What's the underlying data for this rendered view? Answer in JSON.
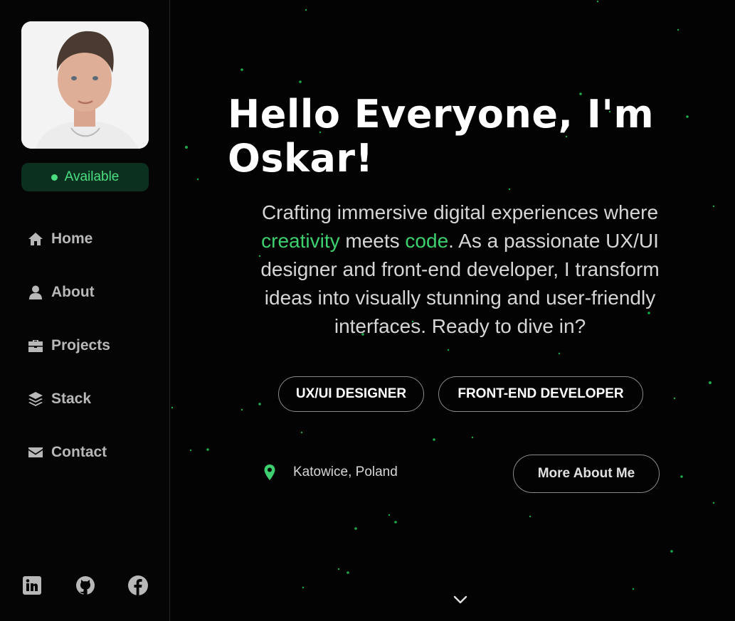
{
  "sidebar": {
    "status_label": "Available",
    "nav": [
      {
        "label": "Home",
        "icon": "home-icon"
      },
      {
        "label": "About",
        "icon": "user-icon"
      },
      {
        "label": "Projects",
        "icon": "briefcase-icon"
      },
      {
        "label": "Stack",
        "icon": "layers-icon"
      },
      {
        "label": "Contact",
        "icon": "envelope-icon"
      }
    ],
    "socials": [
      {
        "icon": "linkedin-icon"
      },
      {
        "icon": "github-icon"
      },
      {
        "icon": "facebook-icon"
      }
    ]
  },
  "hero": {
    "title": "Hello Everyone, I'm Oskar!",
    "intro": {
      "part1": "Crafting immersive digital experiences where ",
      "highlight1": "creativity",
      "part2": " meets ",
      "highlight2": "code",
      "part3": ". As a passionate UX/UI designer and front-end developer, I transform ideas into visually stunning and user-friendly interfaces. Ready to dive in?"
    },
    "roles": [
      "UX/UI DESIGNER",
      "FRONT-END DEVELOPER"
    ],
    "location": "Katowice, Poland",
    "cta_label": "More About Me"
  },
  "colors": {
    "accent": "#3ecf6e",
    "status_bg": "#0c3020",
    "background": "#030303"
  }
}
